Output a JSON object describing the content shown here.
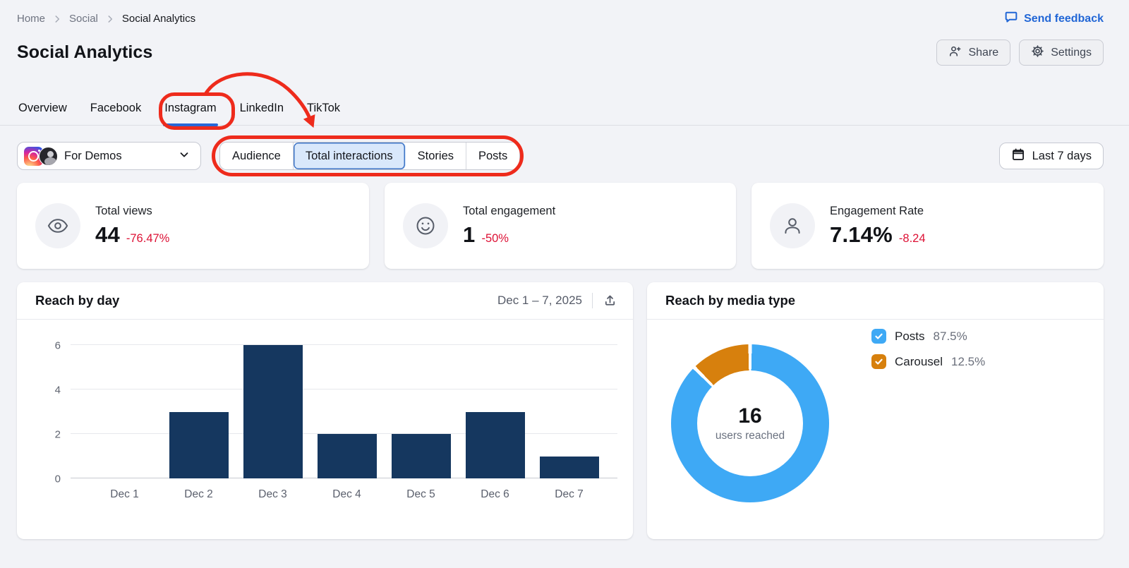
{
  "breadcrumb": {
    "home": "Home",
    "social": "Social",
    "current": "Social Analytics"
  },
  "feedback_label": "Send feedback",
  "header": {
    "title": "Social Analytics",
    "share": "Share",
    "settings": "Settings"
  },
  "tabs": {
    "overview": "Overview",
    "facebook": "Facebook",
    "instagram": "Instagram",
    "linkedin": "LinkedIn",
    "tiktok": "TikTok",
    "active": "Instagram"
  },
  "account": {
    "name": "For Demos"
  },
  "subtabs": {
    "audience": "Audience",
    "total_interactions": "Total interactions",
    "stories": "Stories",
    "posts": "Posts",
    "selected": "Total interactions"
  },
  "daterange_button": "Last 7 days",
  "metrics": {
    "views": {
      "label": "Total views",
      "value": "44",
      "delta": "-76.47%"
    },
    "engagement": {
      "label": "Total engagement",
      "value": "1",
      "delta": "-50%"
    },
    "rate": {
      "label": "Engagement Rate",
      "value": "7.14%",
      "delta": "-8.24"
    }
  },
  "reach_by_day": {
    "title": "Reach by day",
    "daterange": "Dec 1 – 7, 2025"
  },
  "reach_by_media": {
    "title": "Reach by media type",
    "center_value": "16",
    "center_label": "users reached",
    "legend": [
      {
        "label": "Posts",
        "value": "87.5%"
      },
      {
        "label": "Carousel",
        "value": "12.5%"
      }
    ]
  },
  "colors": {
    "accent_blue": "#2767D9",
    "negative_red": "#DD1135",
    "annotation_red": "#EE2B1C",
    "bar_navy": "#15375F",
    "donut_blue": "#3EA9F5",
    "donut_orange": "#D7800D"
  },
  "chart_data": [
    {
      "type": "bar",
      "title": "Reach by day",
      "date_label": "Dec 1 – 7, 2025",
      "categories": [
        "Dec 1",
        "Dec 2",
        "Dec 3",
        "Dec 4",
        "Dec 5",
        "Dec 6",
        "Dec 7"
      ],
      "values": [
        0,
        3,
        6,
        2,
        2,
        3,
        1
      ],
      "yticks": [
        0,
        2,
        4,
        6
      ],
      "ylim": [
        0,
        6
      ],
      "xlabel": "",
      "ylabel": "",
      "grid": true,
      "bar_color": "#15375F"
    },
    {
      "type": "pie",
      "title": "Reach by media type",
      "center_value": 16,
      "center_label": "users reached",
      "legend_position": "right",
      "slices": [
        {
          "label": "Posts",
          "pct": 87.5,
          "color": "#3EA9F5"
        },
        {
          "label": "Carousel",
          "pct": 12.5,
          "color": "#D7800D"
        }
      ]
    }
  ]
}
